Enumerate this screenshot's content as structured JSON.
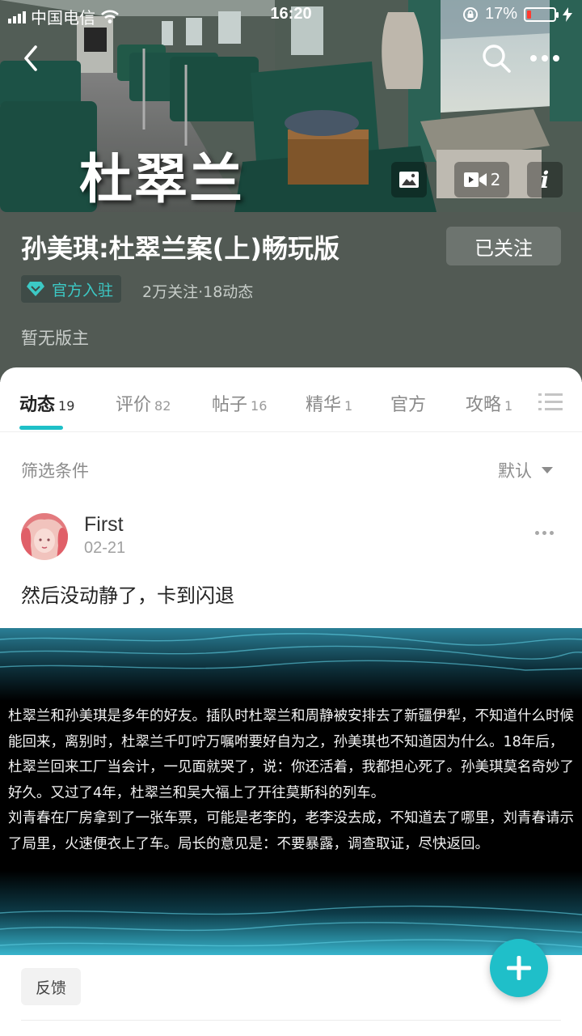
{
  "status_bar": {
    "carrier": "中国电信",
    "time": "16:20",
    "battery": "17%",
    "battery_level": 0.17
  },
  "header": {
    "hero_title": "杜翠兰",
    "video_count": "2"
  },
  "game": {
    "title": "孙美琪:杜翠兰案(上)畅玩版",
    "follow_label": "已关注",
    "official_badge": "官方入驻",
    "stats": "2万关注·18动态",
    "moderator": "暂无版主"
  },
  "tabs": [
    {
      "label": "动态",
      "count": "19"
    },
    {
      "label": "评价",
      "count": "82"
    },
    {
      "label": "帖子",
      "count": "16"
    },
    {
      "label": "精华",
      "count": "1"
    },
    {
      "label": "官方",
      "count": ""
    },
    {
      "label": "攻略",
      "count": "1"
    }
  ],
  "filter": {
    "label": "筛选条件",
    "sort_label": "默认"
  },
  "post": {
    "author": "First",
    "date": "02-21",
    "text": "然后没动静了，卡到闪退",
    "image_text": [
      "杜翠兰和孙美琪是多年的好友。插队时杜翠兰和周静被安排去了新疆伊犁，不知道什么时候能回来，离别时，杜翠兰千叮咛万嘱咐要好自为之，孙美琪也不知道因为什么。18年后，杜翠兰回来工厂当会计，一见面就哭了，说：你还活着，我都担心死了。孙美琪莫名奇妙了好久。又过了4年，杜翠兰和吴大福上了开往莫斯科的列车。",
      "刘青春在厂房拿到了一张车票，可能是老李的，老李没去成，不知道去了哪里，刘青春请示了局里，火速便衣上了车。局长的意见是：不要暴露，调查取证，尽快返回。"
    ]
  },
  "actions": {
    "feedback_label": "反馈"
  },
  "colors": {
    "accent": "#1fc0c8",
    "info_band": "#525a54",
    "battery_low": "#ff3b30"
  }
}
